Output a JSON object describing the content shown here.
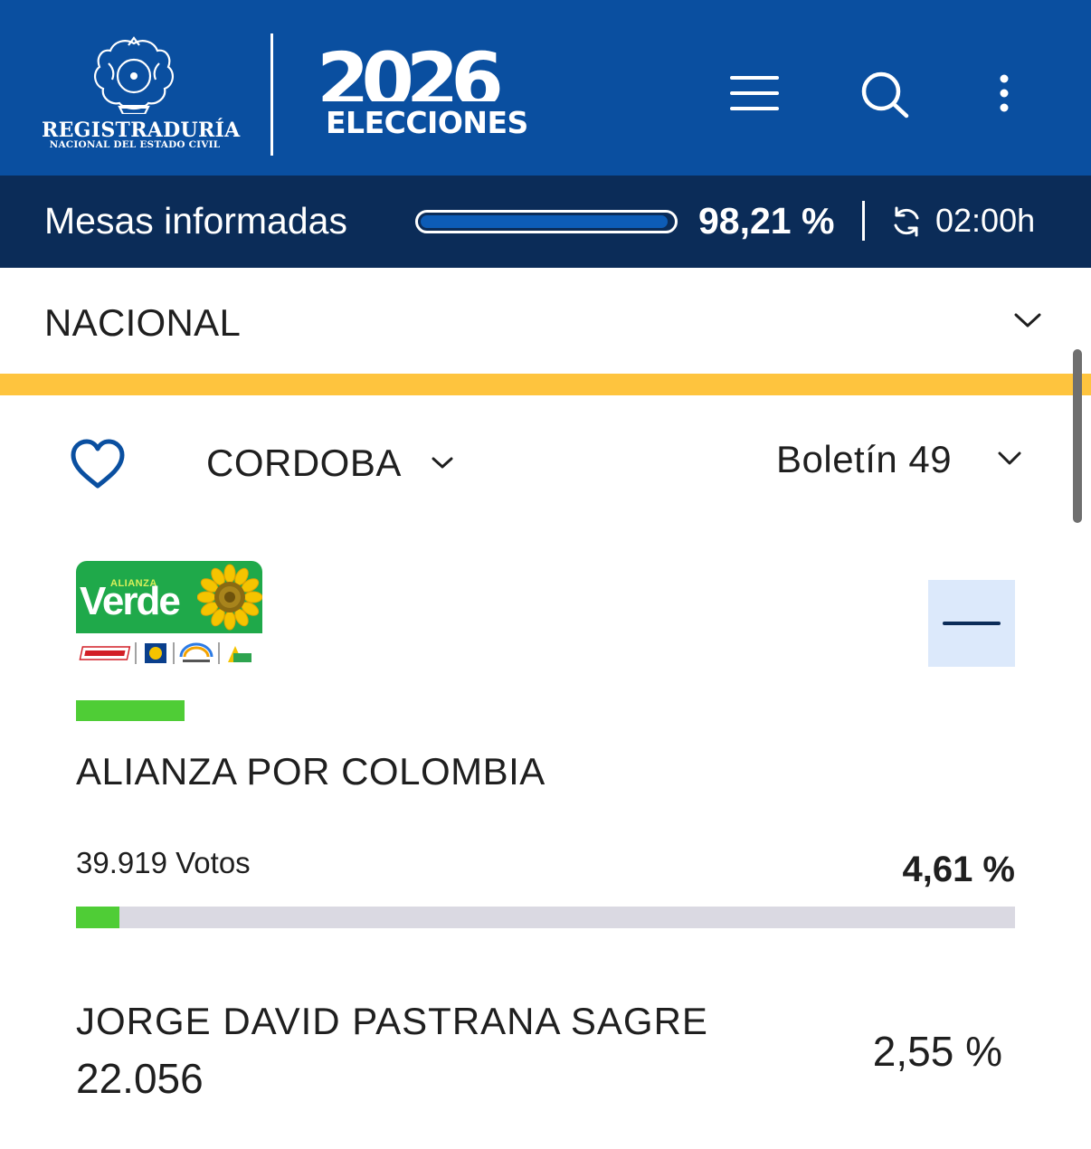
{
  "header": {
    "registraduria_line1": "REGISTRADURÍA",
    "registraduria_line2": "NACIONAL DEL ESTADO CIVIL",
    "year": "2026",
    "elecciones": "ELECCIONES",
    "brand_color": "#0a4fa0",
    "menu_icon": "hamburger-menu-icon",
    "search_icon": "search-icon",
    "more_icon": "vertical-dots-icon"
  },
  "status": {
    "mesas_label": "Mesas informadas",
    "mesas_pct_text": "98,21 %",
    "mesas_fraction": 0.9821,
    "refresh_icon": "refresh-icon",
    "refresh_time": "02:00h",
    "bar_color": "#0b2c58"
  },
  "scope": {
    "selected": "NACIONAL",
    "band_color": "#fec43e"
  },
  "filters": {
    "favorite_icon": "heart-outline-icon",
    "department": "CORDOBA",
    "bulletin": "Boletín 49"
  },
  "party": {
    "logo_alianza": "ALIANZA",
    "logo_verde": "Verde",
    "name": "ALIANZA POR COLOMBIA",
    "votes_text": "39.919 Votos",
    "pct_text": "4,61 %",
    "vote_fraction": 0.0461,
    "color": "#4fcd36",
    "collapse_icon": "minus-icon"
  },
  "candidates": [
    {
      "name": "JORGE DAVID PASTRANA SAGRE",
      "votes": "22.056",
      "pct": "2,55 %"
    }
  ]
}
